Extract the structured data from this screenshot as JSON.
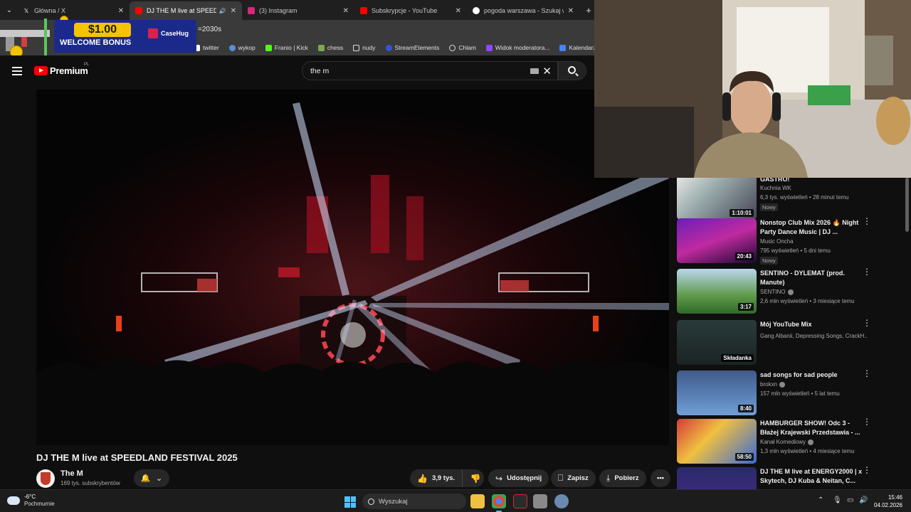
{
  "browser": {
    "tabs": [
      {
        "title": "Główna / X",
        "active": false
      },
      {
        "title": "DJ THE M live at SPEEDLAND",
        "active": true
      },
      {
        "title": "(3) Instagram",
        "active": false
      },
      {
        "title": "Subskrypcje - YouTube",
        "active": false
      },
      {
        "title": "pogoda warszawa - Szukaj w Go",
        "active": false
      }
    ],
    "url_fragment": "=2030s",
    "bookmarks": [
      "twitter",
      "wykop",
      "Franio | Kick",
      "chess",
      "nudy",
      "StreamElements",
      "Chlam",
      "Widok moderatora...",
      "Kalendarz G"
    ]
  },
  "ad": {
    "amount": "$1.00",
    "text": "WELCOME BONUS",
    "brand": "CaseHug"
  },
  "youtube": {
    "logo_word": "Premium",
    "region": "PL",
    "search_query": "the m"
  },
  "video": {
    "title": "DJ THE M live at SPEEDLAND FESTIVAL 2025",
    "channel": "The M",
    "subscribers": "169 tys. subskrybentów",
    "likes": "3,9 tys.",
    "share_label": "Udostępnij",
    "save_label": "Zapisz",
    "download_label": "Pobierz"
  },
  "recommendations": [
    {
      "title": "GASTRO!",
      "channel": "Kuchnia WK",
      "meta": "6,3 tys. wyświetleń • 28 minut temu",
      "badge": "Nowy",
      "duration": "1:10:01"
    },
    {
      "title": "Nonstop Club Mix 2026 🔥 Night Party Dance Music | DJ ...",
      "channel": "Music Oncha",
      "meta": "795 wyświetleń • 5 dni temu",
      "badge": "Nowy",
      "duration": "20:43"
    },
    {
      "title": "SENTINO - DYLEMAT (prod. Manute)",
      "channel": "SENTINO",
      "meta": "2,6 mln wyświetleń • 3 miesiące temu",
      "badge": "",
      "duration": "3:17"
    },
    {
      "title": "Mój YouTube Mix",
      "channel": "Gang Albanii, Depressing Songs, CrackH...",
      "meta": "",
      "badge": "",
      "duration": "Składanka"
    },
    {
      "title": "sad songs for sad people",
      "channel": "brokxn",
      "meta": "157 mln wyświetleń • 5 lat temu",
      "badge": "",
      "duration": "8:40"
    },
    {
      "title": "HAMBURGER SHOW! Odc 3 - Błażej Krajewski Przedstawia - ...",
      "channel": "Kanał Komediowy",
      "meta": "1,3 mln wyświetleń • 4 miesiące temu",
      "badge": "",
      "duration": "58:50"
    },
    {
      "title": "DJ THE M live at ENERGY2000 | x Skytech, DJ Kuba & Neitan, C...",
      "channel": "",
      "meta": "",
      "badge": "",
      "duration": ""
    }
  ],
  "taskbar": {
    "temperature": "-6°C",
    "condition": "Pochmurnie",
    "search_label": "Wyszukaj",
    "time": "15:46",
    "date": "04.02.2026"
  },
  "colors": {
    "youtube_red": "#ff0000",
    "accent_blue": "#4cc2ff",
    "background": "#0f0f0f"
  }
}
